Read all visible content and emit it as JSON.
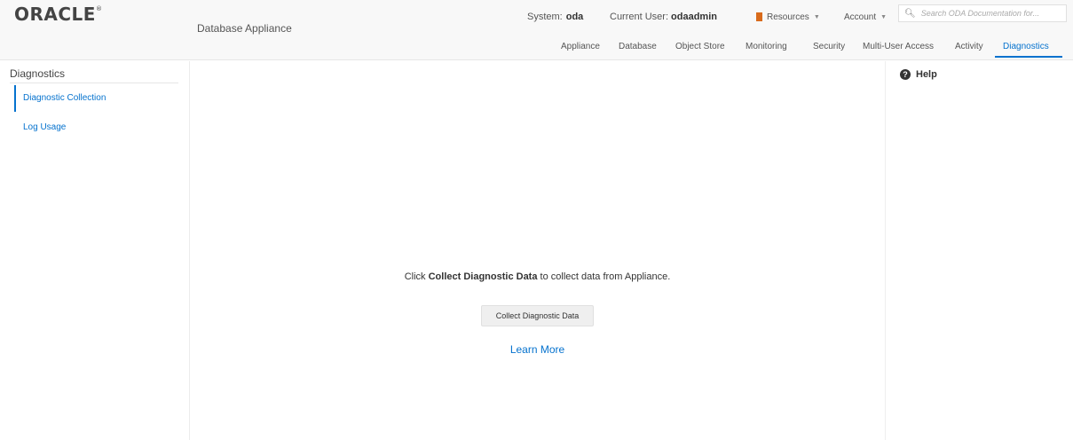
{
  "header": {
    "logo": "ORACLE",
    "app_title": "Database Appliance",
    "system_label": "System:",
    "system_value": "oda",
    "user_label": "Current User:",
    "user_value": "odaadmin",
    "resources_label": "Resources",
    "account_label": "Account",
    "search_placeholder": "Search ODA Documentation for..."
  },
  "nav": [
    {
      "label": "Appliance",
      "active": false
    },
    {
      "label": "Database",
      "active": false
    },
    {
      "label": "Object Store",
      "active": false
    },
    {
      "label": "Monitoring",
      "active": false
    },
    {
      "label": "Security",
      "active": false
    },
    {
      "label": "Multi-User Access",
      "active": false
    },
    {
      "label": "Activity",
      "active": false
    },
    {
      "label": "Diagnostics",
      "active": true
    }
  ],
  "sidebar": {
    "title": "Diagnostics",
    "items": [
      {
        "label": "Diagnostic Collection",
        "selected": true
      },
      {
        "label": "Log Usage",
        "selected": false
      }
    ]
  },
  "main": {
    "msg_prefix": "Click",
    "msg_bold": "Collect Diagnostic Data",
    "msg_suffix": "to collect data from Appliance.",
    "button_label": "Collect Diagnostic Data",
    "learn_more": "Learn More"
  },
  "help": {
    "label": "Help",
    "icon": "question-circle-icon"
  },
  "colors": {
    "accent": "#0572ce",
    "resources_icon": "#d96b1c"
  }
}
